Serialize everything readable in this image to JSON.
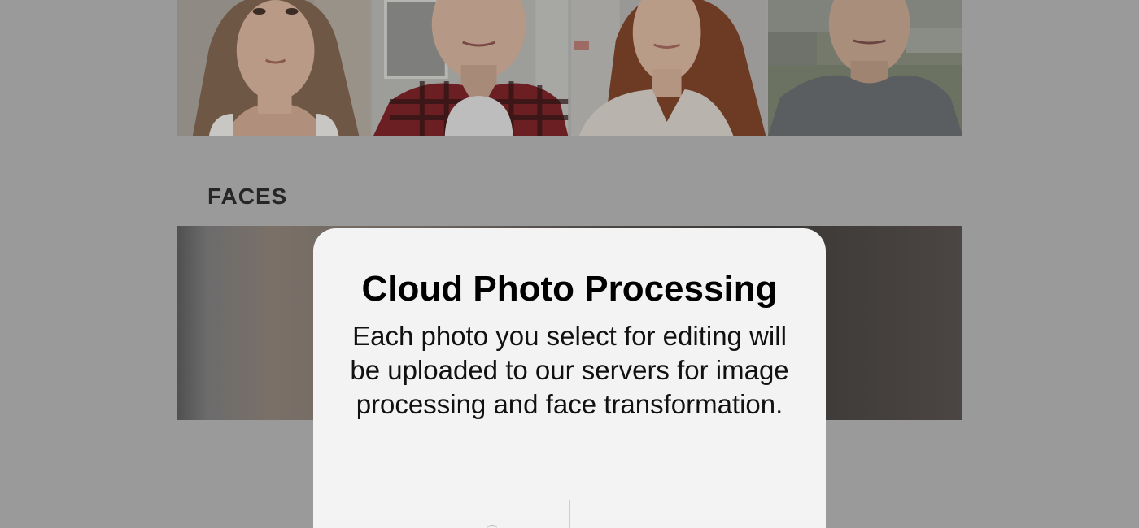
{
  "photos": [
    {
      "name": "woman-blonde-photo"
    },
    {
      "name": "man-plaid-shirt-photo"
    },
    {
      "name": "woman-red-hair-photo"
    },
    {
      "name": "man-gray-sweater-photo"
    }
  ],
  "sections": {
    "faces_title": "FACES"
  },
  "dialog": {
    "title": "Cloud Photo Processing",
    "message": "Each photo you select for editing will be uploaded to our servers for image processing and face transformation.",
    "buttons": [
      "",
      ""
    ]
  },
  "colors": {
    "overlay_background": "#9a9a9a",
    "dialog_background": "#f3f3f3",
    "divider": "#cfcfcf"
  }
}
